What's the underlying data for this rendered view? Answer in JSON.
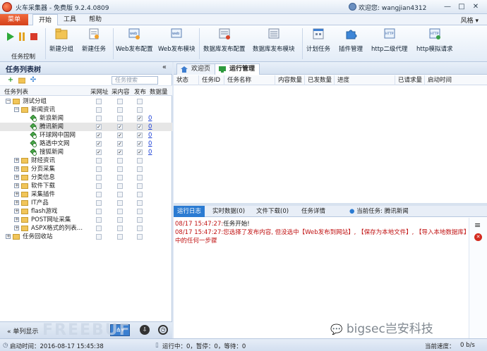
{
  "app": {
    "title": "火车采集器 - 免费版 9.2.4.0809",
    "welcome": "欢迎您: wangjian4312",
    "style_menu": "风格"
  },
  "menubar": {
    "menu_button": "菜单",
    "tabs": [
      "开始",
      "工具",
      "帮助"
    ]
  },
  "ribbon": {
    "task_control_label": "任务控制",
    "buttons": [
      "新建分组",
      "新建任务",
      "Web发布配置",
      "Web发布模块",
      "数据库发布配置",
      "数据库发布模块",
      "计划任务",
      "插件管理",
      "http二级代理",
      "http模拟请求"
    ]
  },
  "left_panel": {
    "title": "任务列表树",
    "search_placeholder": "任务搜索",
    "columns": [
      "任务列表",
      "采网址",
      "采内容",
      "发布",
      "数据量"
    ],
    "rows": [
      {
        "label": "测试分组",
        "level": 0,
        "type": "folder",
        "expand": "−",
        "c1": "",
        "c2": "",
        "c3": "",
        "count": ""
      },
      {
        "label": "新闻资讯",
        "level": 1,
        "type": "folder",
        "expand": "−",
        "c1": "",
        "c2": "",
        "c3": "",
        "count": ""
      },
      {
        "label": "新浪新闻",
        "level": 2,
        "type": "task",
        "expand": "",
        "c1": "",
        "c2": "",
        "c3": "✓",
        "count": "0"
      },
      {
        "label": "腾讯新闻",
        "level": 2,
        "type": "task",
        "expand": "",
        "c1": "✓",
        "c2": "✓",
        "c3": "✓",
        "count": "0",
        "selected": true
      },
      {
        "label": "环球网中国网",
        "level": 2,
        "type": "task",
        "expand": "",
        "c1": "✓",
        "c2": "✓",
        "c3": "✓",
        "count": "0"
      },
      {
        "label": "路透中文网",
        "level": 2,
        "type": "task",
        "expand": "",
        "c1": "✓",
        "c2": "✓",
        "c3": "✓",
        "count": "0"
      },
      {
        "label": "搜狐新闻",
        "level": 2,
        "type": "task",
        "expand": "",
        "c1": "✓",
        "c2": "✓",
        "c3": "✓",
        "count": "0"
      },
      {
        "label": "财经资讯",
        "level": 1,
        "type": "folder",
        "expand": "+",
        "c1": "",
        "c2": "",
        "c3": "",
        "count": ""
      },
      {
        "label": "分页采集",
        "level": 1,
        "type": "folder",
        "expand": "+",
        "c1": "",
        "c2": "",
        "c3": "",
        "count": ""
      },
      {
        "label": "分类信息",
        "level": 1,
        "type": "folder",
        "expand": "+",
        "c1": "",
        "c2": "",
        "c3": "",
        "count": ""
      },
      {
        "label": "软件下载",
        "level": 1,
        "type": "folder",
        "expand": "+",
        "c1": "",
        "c2": "",
        "c3": "",
        "count": ""
      },
      {
        "label": "采集插件",
        "level": 1,
        "type": "folder",
        "expand": "+",
        "c1": "",
        "c2": "",
        "c3": "",
        "count": ""
      },
      {
        "label": "IT产品",
        "level": 1,
        "type": "folder",
        "expand": "+",
        "c1": "",
        "c2": "",
        "c3": "",
        "count": ""
      },
      {
        "label": "flash游戏",
        "level": 1,
        "type": "folder",
        "expand": "+",
        "c1": "",
        "c2": "",
        "c3": "",
        "count": ""
      },
      {
        "label": "POST网址采集",
        "level": 1,
        "type": "folder",
        "expand": "+",
        "c1": "",
        "c2": "",
        "c3": "",
        "count": ""
      },
      {
        "label": "ASPX格式的列表…",
        "level": 1,
        "type": "folder",
        "expand": "+",
        "c1": "",
        "c2": "",
        "c3": "",
        "count": ""
      },
      {
        "label": "任务回收站",
        "level": 0,
        "type": "folder",
        "expand": "+",
        "c1": "",
        "c2": "",
        "c3": "",
        "count": ""
      }
    ],
    "footer_label": "单列显示"
  },
  "right_panel": {
    "tabs": [
      "欢迎页",
      "运行管理"
    ],
    "grid_columns": [
      "状态",
      "任务ID",
      "任务名称",
      "内容数量",
      "已发数量",
      "进度",
      "已请求量",
      "启动时间"
    ],
    "log_tabs": [
      "运行日志",
      "实时数据(0)",
      "文件下载(0)",
      "任务详情"
    ],
    "current_task": "当前任务: 腾讯新闻",
    "log_lines": [
      {
        "ts": "08/17 15:47:27:",
        "text": "任务开始!",
        "color": "black"
      },
      {
        "ts": "08/17 15:47:27:",
        "text": "您选择了发布内容, 但没选中【Web发布到网站】, 【保存为本地文件】, 【导入本地数据库】中的任何一步骤",
        "color": "red"
      }
    ]
  },
  "statusbar": {
    "start_time": "启动时间：2016-08-17 15:45:38",
    "running": "运行中：0，暂停：0，等待：0",
    "speed_label": "当前速度：",
    "speed_value": "0 b/s"
  },
  "watermark": {
    "text": "bigsec岂安科技",
    "faded": "FREEBUF"
  }
}
